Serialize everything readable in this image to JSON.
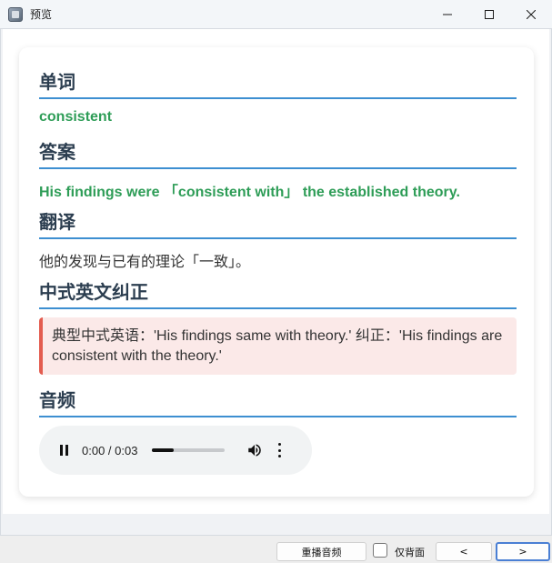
{
  "window": {
    "title": "预览",
    "controls": [
      "minimize-icon",
      "maximize-icon",
      "close-icon"
    ]
  },
  "sections": {
    "word": {
      "title": "单词",
      "value": "consistent"
    },
    "answer": {
      "title": "答案",
      "value": "His findings were 「consistent with」 the established theory."
    },
    "translation": {
      "title": "翻译",
      "value": "他的发现与已有的理论「一致」。"
    },
    "chinglish": {
      "title": "中式英文纠正",
      "note": "典型中式英语：'His findings same with theory.' 纠正：'His findings are consistent with the theory.'"
    },
    "audio": {
      "title": "音频",
      "time": "0:00 / 0:03",
      "progress": 0.3,
      "state": "playing"
    }
  },
  "bottombar": {
    "replay_label": "重播音频",
    "back_only_label": "仅背面",
    "back_only_checked": false,
    "prev_label": "<",
    "next_label": ">"
  },
  "colors": {
    "accent_line": "#3d8fd1",
    "green_text": "#2e9d57",
    "note_bg": "#fbe9e8",
    "note_border": "#e35c4f"
  }
}
